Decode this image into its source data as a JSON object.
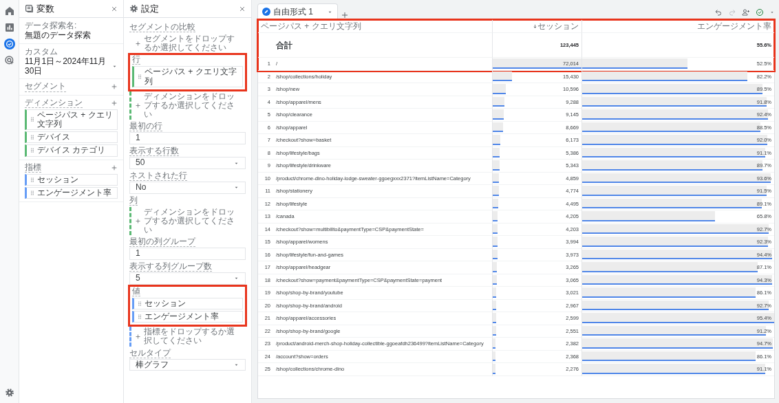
{
  "rail": {
    "items": [
      {
        "kind": "home",
        "selected": false
      },
      {
        "kind": "reports",
        "selected": false
      },
      {
        "kind": "explore",
        "selected": true
      },
      {
        "kind": "advertising",
        "selected": false
      }
    ],
    "bottom": {
      "kind": "settings"
    }
  },
  "variables_panel": {
    "title": "変数",
    "fields": [
      {
        "kind": "text",
        "label": "データ探索名:",
        "value": "無題のデータ探索"
      },
      {
        "kind": "select",
        "label": "カスタム",
        "value": "11月1日～2024年11月30日"
      }
    ],
    "sections": [
      {
        "label": "セグメント"
      },
      {
        "label": "ディメンション",
        "items": [
          {
            "text": "ページパス + クエリ文字列",
            "kind": "dimension"
          },
          {
            "text": "デバイス",
            "kind": "dimension"
          },
          {
            "text": "デバイス カテゴリ",
            "kind": "dimension"
          }
        ]
      },
      {
        "label": "指標",
        "items": [
          {
            "text": "セッション",
            "kind": "metric"
          },
          {
            "text": "エンゲージメント率",
            "kind": "metric"
          }
        ]
      }
    ]
  },
  "settings_panel": {
    "title": "設定",
    "sections": [
      {
        "kind": "drop",
        "label": "セグメントの比較",
        "drop": {
          "hint": "セグメントをドロップするか選択してください"
        }
      },
      {
        "kind": "drop",
        "label": "行",
        "highlighted": true,
        "items": [
          {
            "text": "ページパス + クエリ文字列",
            "kind": "dimension"
          }
        ],
        "drop": {
          "hint": "ディメンションをドロップするか選択してください",
          "color": "#5bb974"
        }
      },
      {
        "kind": "number",
        "label": "最初の行",
        "value": "1"
      },
      {
        "kind": "select",
        "label": "表示する行数",
        "value": "50"
      },
      {
        "kind": "select",
        "label": "ネストされた行",
        "value": "No"
      },
      {
        "kind": "drop",
        "label": "列",
        "drop": {
          "hint": "ディメンションをドロップするか選択してください",
          "color": "#5bb974"
        }
      },
      {
        "kind": "number",
        "label": "最初の列グループ",
        "value": "1"
      },
      {
        "kind": "select",
        "label": "表示する列グループ数",
        "value": "5"
      },
      {
        "kind": "drop",
        "label": "値",
        "highlighted": true,
        "items": [
          {
            "text": "セッション",
            "kind": "metric"
          },
          {
            "text": "エンゲージメント率",
            "kind": "metric"
          }
        ],
        "drop": {
          "hint": "指標をドロップするか選択してください",
          "color": "#669df6"
        }
      },
      {
        "kind": "select",
        "label": "セルタイプ",
        "value": "棒グラフ"
      }
    ]
  },
  "tabs": [
    {
      "label": "自由形式 1",
      "selected": true
    }
  ],
  "table": {
    "highlighted": true,
    "columns": [
      {
        "label": "ページパス + クエリ文字列",
        "sorted": false
      },
      {
        "label": "セッション",
        "sorted": true
      },
      {
        "label": "エンゲージメント率",
        "sorted": false
      }
    ],
    "total": {
      "label": "合計",
      "values": [
        "123,445",
        "55.6%"
      ]
    },
    "rows": [
      {
        "index": "1",
        "path": "/",
        "sessions": {
          "text": "72,014",
          "level": 1
        },
        "engagement": {
          "text": "52.5%",
          "level": 0.55
        }
      },
      {
        "index": "2",
        "path": "/shop/collections/holiday",
        "sessions": {
          "text": "15,430",
          "level": 0.214
        },
        "engagement": {
          "text": "82.2%",
          "level": 0.862
        }
      },
      {
        "index": "3",
        "path": "/shop/new",
        "sessions": {
          "text": "10,596",
          "level": 0.147
        },
        "engagement": {
          "text": "89.5%",
          "level": 0.938
        }
      },
      {
        "index": "4",
        "path": "/shop/apparel/mens",
        "sessions": {
          "text": "9,288",
          "level": 0.129
        },
        "engagement": {
          "text": "91.8%",
          "level": 0.962
        }
      },
      {
        "index": "5",
        "path": "/shop/clearance",
        "sessions": {
          "text": "9,145",
          "level": 0.127
        },
        "engagement": {
          "text": "92.4%",
          "level": 0.969
        }
      },
      {
        "index": "6",
        "path": "/shop/apparel",
        "sessions": {
          "text": "8,669",
          "level": 0.12
        },
        "engagement": {
          "text": "88.5%",
          "level": 0.928
        }
      },
      {
        "index": "7",
        "path": "/checkout?show=basket",
        "sessions": {
          "text": "6,173",
          "level": 0.086
        },
        "engagement": {
          "text": "92.0%",
          "level": 0.964
        }
      },
      {
        "index": "8",
        "path": "/shop/lifestyle/bags",
        "sessions": {
          "text": "5,386",
          "level": 0.075
        },
        "engagement": {
          "text": "91.1%",
          "level": 0.955
        }
      },
      {
        "index": "9",
        "path": "/shop/lifestyle/drinkware",
        "sessions": {
          "text": "5,343",
          "level": 0.074
        },
        "engagement": {
          "text": "89.7%",
          "level": 0.94
        }
      },
      {
        "index": "10",
        "path": "/product/chrome-dino-holiday-lodge-sweater-ggoegxxx2371?itemListName=Category",
        "sessions": {
          "text": "4,859",
          "level": 0.067
        },
        "engagement": {
          "text": "93.6%",
          "level": 0.981
        }
      },
      {
        "index": "11",
        "path": "/shop/stationery",
        "sessions": {
          "text": "4,774",
          "level": 0.066
        },
        "engagement": {
          "text": "91.5%",
          "level": 0.959
        }
      },
      {
        "index": "12",
        "path": "/shop/lifestyle",
        "sessions": {
          "text": "4,495",
          "level": 0.062
        },
        "engagement": {
          "text": "89.1%",
          "level": 0.934
        }
      },
      {
        "index": "13",
        "path": "/canada",
        "sessions": {
          "text": "4,205",
          "level": 0.058
        },
        "engagement": {
          "text": "65.8%",
          "level": 0.69
        }
      },
      {
        "index": "14",
        "path": "/checkout?show=multibillto&paymentType=CSP&paymentState=",
        "sessions": {
          "text": "4,203",
          "level": 0.058
        },
        "engagement": {
          "text": "92.7%",
          "level": 0.972
        }
      },
      {
        "index": "15",
        "path": "/shop/apparel/womens",
        "sessions": {
          "text": "3,994",
          "level": 0.055
        },
        "engagement": {
          "text": "92.3%",
          "level": 0.968
        }
      },
      {
        "index": "16",
        "path": "/shop/lifestyle/fun-and-games",
        "sessions": {
          "text": "3,973",
          "level": 0.055
        },
        "engagement": {
          "text": "94.4%",
          "level": 0.99
        }
      },
      {
        "index": "17",
        "path": "/shop/apparel/headgear",
        "sessions": {
          "text": "3,265",
          "level": 0.045
        },
        "engagement": {
          "text": "87.1%",
          "level": 0.913
        }
      },
      {
        "index": "18",
        "path": "/checkout?show=payment&paymentType=CSP&paymentState=payment",
        "sessions": {
          "text": "3,065",
          "level": 0.043
        },
        "engagement": {
          "text": "94.3%",
          "level": 0.988
        }
      },
      {
        "index": "19",
        "path": "/shop/shop-by-brand/youtube",
        "sessions": {
          "text": "3,021",
          "level": 0.042
        },
        "engagement": {
          "text": "86.1%",
          "level": 0.903
        }
      },
      {
        "index": "20",
        "path": "/shop/shop-by-brand/android",
        "sessions": {
          "text": "2,967",
          "level": 0.041
        },
        "engagement": {
          "text": "92.7%",
          "level": 0.972
        }
      },
      {
        "index": "21",
        "path": "/shop/apparel/accessories",
        "sessions": {
          "text": "2,599",
          "level": 0.036
        },
        "engagement": {
          "text": "95.4%",
          "level": 1
        }
      },
      {
        "index": "22",
        "path": "/shop/shop-by-brand/google",
        "sessions": {
          "text": "2,551",
          "level": 0.035
        },
        "engagement": {
          "text": "91.2%",
          "level": 0.956
        }
      },
      {
        "index": "23",
        "path": "/product/android-merch-shop-holiday-collectible-ggoeafdh236499?itemListName=Category",
        "sessions": {
          "text": "2,382",
          "level": 0.033
        },
        "engagement": {
          "text": "94.7%",
          "level": 0.993
        }
      },
      {
        "index": "24",
        "path": "/account?show=orders",
        "sessions": {
          "text": "2,368",
          "level": 0.033
        },
        "engagement": {
          "text": "86.1%",
          "level": 0.903
        }
      },
      {
        "index": "25",
        "path": "/shop/collections/chrome-dino",
        "sessions": {
          "text": "2,276",
          "level": 0.032
        },
        "engagement": {
          "text": "91.1%",
          "level": 0.955
        }
      }
    ]
  }
}
